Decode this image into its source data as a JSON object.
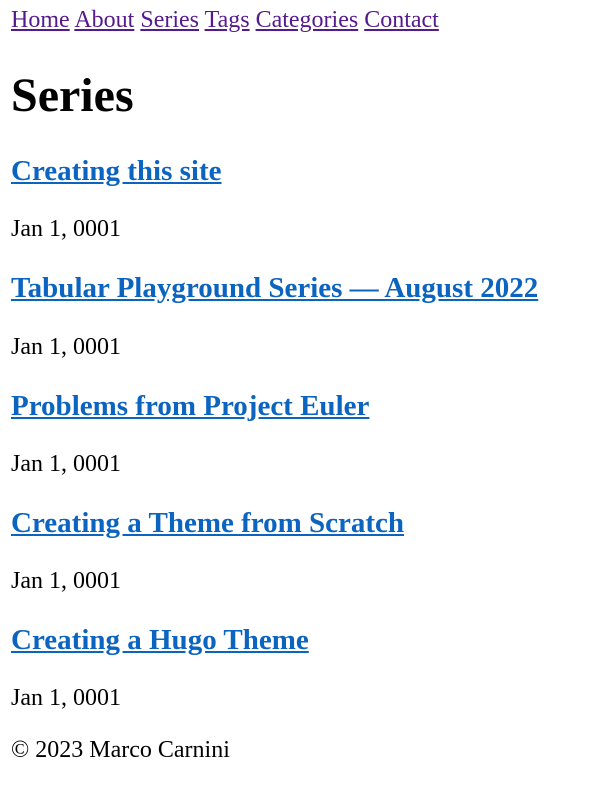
{
  "nav": {
    "home": "Home",
    "about": "About",
    "series": "Series",
    "tags": "Tags",
    "categories": "Categories",
    "contact": "Contact"
  },
  "page_title": "Series",
  "posts": [
    {
      "title": "Creating this site",
      "date": "Jan 1, 0001"
    },
    {
      "title": "Tabular Playground Series — August 2022",
      "date": "Jan 1, 0001"
    },
    {
      "title": "Problems from Project Euler",
      "date": "Jan 1, 0001"
    },
    {
      "title": "Creating a Theme from Scratch",
      "date": "Jan 1, 0001"
    },
    {
      "title": "Creating a Hugo Theme",
      "date": "Jan 1, 0001"
    }
  ],
  "footer": {
    "text": "© 2023 Marco Carnini"
  },
  "colors": {
    "nav_link": "#551a8b",
    "post_link": "#0b64c0",
    "text": "#000000",
    "background": "#ffffff"
  }
}
